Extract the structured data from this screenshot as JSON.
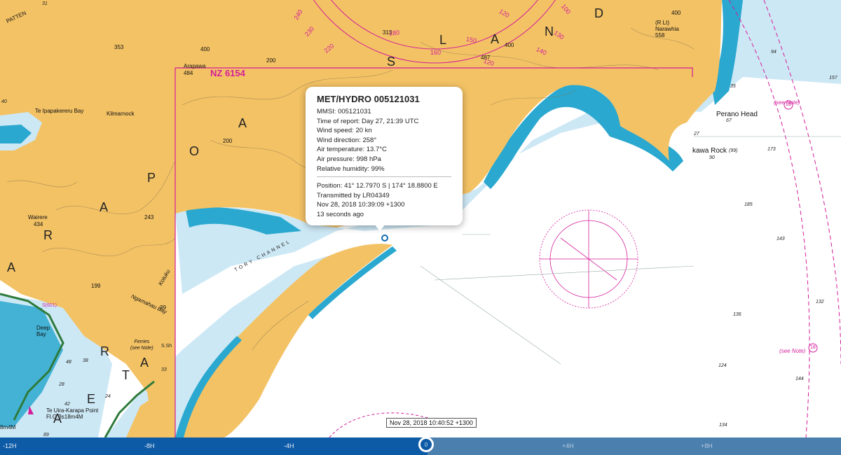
{
  "chart": {
    "chart_number": "NZ 6154",
    "area_letters": [
      "S",
      "L",
      "A",
      "N",
      "D",
      "A",
      "O",
      "P",
      "A",
      "R",
      "A",
      "R",
      "A",
      "T",
      "E",
      "A"
    ],
    "places": {
      "patten": "PATTEN",
      "arapawa": "Arapawa",
      "arapawa_height": "484",
      "kilmarnock": "Kilmarnock",
      "te_ipapakereru": "Te Ipapakereru Bay",
      "wairere": "Wairere",
      "wairere_height": "434",
      "narawhia": "(R Lt)\nNarawhia\n558",
      "perano_head": "Perano Head",
      "kawa_rock": "kawa Rock",
      "kawa_depth": "(99)",
      "deep_bay": "Deep\nBay",
      "ferries": "Ferries\n(see Note)",
      "ngamahau_bay": "Ngamahau Bay",
      "kotuku": "Kotuku",
      "te_uira": "Te Uira-Karapa Point\nFl.G.3s18m4M",
      "light_left": "8m4M",
      "tory_channel": "TORY CHANNEL",
      "see_note_1": "(see Note)",
      "see_note_2": "(see Note)",
      "circle_18": "18",
      "s601": "S(601)",
      "ssh": "S.Sh"
    },
    "heights": [
      "353",
      "400",
      "200",
      "243",
      "199",
      "313",
      "400",
      "487",
      "400",
      "200",
      "39"
    ],
    "depths": [
      "157",
      "94",
      "173",
      "185",
      "143",
      "132",
      "136",
      "124",
      "144",
      "134",
      "67",
      "90",
      "35",
      "27",
      "38",
      "24",
      "28",
      "42",
      "33",
      "40",
      "31",
      "48",
      "89"
    ],
    "compass_numbers": [
      "240",
      "230",
      "220",
      "180",
      "160",
      "150",
      "140",
      "130",
      "120",
      "100",
      "120"
    ]
  },
  "popup": {
    "title": "MET/HYDRO 005121031",
    "mmsi": "MMSI: 005121031",
    "time_of_report": "Time of report: Day 27, 21:39 UTC",
    "wind_speed": "Wind speed: 20 kn",
    "wind_direction": "Wind direction: 258°",
    "air_temperature": "Air temperature: 13.7°C",
    "air_pressure": "Air pressure: 998 hPa",
    "humidity": "Relative humidity: 99%",
    "position": "Position: 41° 12.7970 S | 174° 18.8800 E",
    "transmitted_by": "Transmitted by LR04349",
    "timestamp": "Nov 28, 2018 10:39:09 +1300",
    "age": "13 seconds ago"
  },
  "current_time_stamp": "Nov 28, 2018 10:40:52 +1300",
  "timebar": {
    "ticks": [
      "-12H",
      "-8H",
      "-4H",
      "0",
      "+4H",
      "+8H"
    ],
    "current": "0"
  },
  "colors": {
    "land": "#f3c265",
    "shallow_water": "#cde8f5",
    "deep_water": "#ffffff",
    "intertidal": "#2aa8cf",
    "magenta": "#d41e9a",
    "timebar": "#1469b0"
  }
}
